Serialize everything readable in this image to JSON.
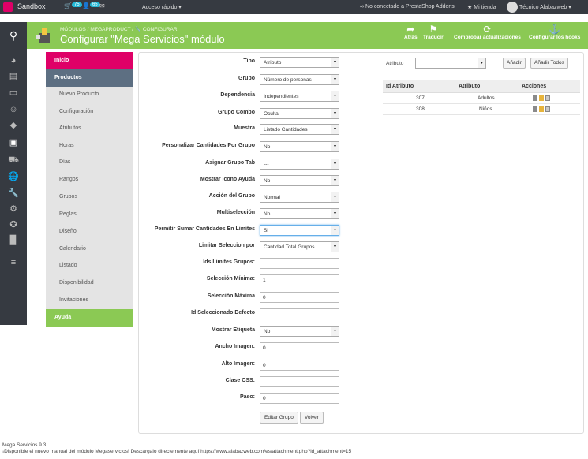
{
  "topbar": {
    "brand": "Sandbox",
    "orders_badge": "75",
    "customers_badge": "65",
    "quick_access": "Acceso rápido ▾",
    "addons_status": "No conectado a PrestaShop Addons",
    "shop": "Mi tienda",
    "user": "Técnico Alabazweb ▾"
  },
  "header": {
    "breadcrumb_module": "MÓDULOS",
    "breadcrumb_sep": "/",
    "breadcrumb_name": "MEGAPRODUCT",
    "breadcrumb_action": "CONFIGURAR",
    "title": "Configurar \"Mega Servicios\" módulo",
    "buttons": {
      "back": "Atrás",
      "translate": "Traducir",
      "check_updates": "Comprobar actualizaciones",
      "configure_hooks": "Configurar los hooks"
    }
  },
  "subnav": {
    "items": [
      "Inicio",
      "Productos",
      "Nuevo Producto",
      "Configuración",
      "Atributos",
      "Horas",
      "Días",
      "Rangos",
      "Grupos",
      "Reglas",
      "Diseño",
      "Calendario",
      "Listado",
      "Disponibilidad",
      "Invitaciones",
      "Ayuda"
    ]
  },
  "form": {
    "tipo": {
      "label": "Tipo",
      "value": "Atributo"
    },
    "grupo": {
      "label": "Grupo",
      "value": "Número de personas"
    },
    "dependencia": {
      "label": "Dependencia",
      "value": "Independientes"
    },
    "grupo_combo": {
      "label": "Grupo Combo",
      "value": "Oculta"
    },
    "muestra": {
      "label": "Muestra",
      "value": "Listado Cantidades"
    },
    "personalizar": {
      "label": "Personalizar Cantidades Por Grupo",
      "value": "No"
    },
    "asignar_tab": {
      "label": "Asignar Grupo Tab",
      "value": "---"
    },
    "mostrar_icono": {
      "label": "Mostrar Icono Ayuda",
      "value": "No"
    },
    "accion_grupo": {
      "label": "Acción del Grupo",
      "value": "Normal"
    },
    "multiseleccion": {
      "label": "Multiselección",
      "value": "No"
    },
    "permitir_sumar": {
      "label": "Permitir Sumar Cantidades En Limites",
      "value": "Si"
    },
    "limitar_seleccion": {
      "label": "Limitar Seleccion por",
      "value": "Cantidad Total Grupos"
    },
    "ids_limites": {
      "label": "Ids Limites Grupos:",
      "value": ""
    },
    "seleccion_minima": {
      "label": "Selección Mínima:",
      "value": "1"
    },
    "seleccion_maxima": {
      "label": "Selección Máxima",
      "value": "0"
    },
    "id_seleccionado": {
      "label": "Id Seleccionado Defecto",
      "value": ""
    },
    "mostrar_etiqueta": {
      "label": "Mostrar Etiqueta",
      "value": "No"
    },
    "ancho_imagen": {
      "label": "Ancho Imagen:",
      "value": "0"
    },
    "alto_imagen": {
      "label": "Alto Imagen:",
      "value": "0"
    },
    "clase_css": {
      "label": "Clase CSS:",
      "value": ""
    },
    "paso": {
      "label": "Paso:",
      "value": "0"
    },
    "edit_button": "Editar Grupo",
    "back_button": "Volver"
  },
  "attributes": {
    "label": "Atributo",
    "select_value": "",
    "add_button": "Añadir",
    "add_all_button": "Añadir Todos",
    "columns": [
      "Id Atributo",
      "Atributo",
      "Acciones"
    ],
    "rows": [
      {
        "id": "307",
        "name": "Adultos"
      },
      {
        "id": "308",
        "name": "Niños"
      }
    ]
  },
  "footer": {
    "version": "Mega Servicios 9.3",
    "notice": "¡Disponible el nuevo manual del módulo Megaservicios! Descárgalo directemente aquí https://www.alabazweb.com/es/attachment.php?id_attachment=15"
  },
  "colors": {
    "accent_green": "#8bc954",
    "pink": "#df0067",
    "sidebar_dark": "#363a41",
    "blue_badge": "#25b9d7"
  }
}
